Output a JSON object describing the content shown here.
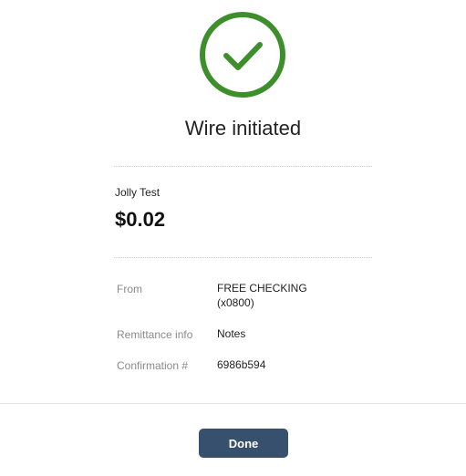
{
  "status": {
    "title": "Wire initiated",
    "icon": "checkmark-circle-icon",
    "accent_color": "#3c8f2b"
  },
  "wire": {
    "payee": "Jolly Test",
    "amount": "$0.02"
  },
  "details": {
    "from": {
      "label": "From",
      "value_line1": "FREE CHECKING",
      "value_line2": "(x0800)"
    },
    "remittance": {
      "label": "Remittance info",
      "value": "Notes"
    },
    "confirmation": {
      "label": "Confirmation #",
      "value": "6986b594"
    }
  },
  "actions": {
    "done_label": "Done",
    "button_color": "#37506d"
  }
}
